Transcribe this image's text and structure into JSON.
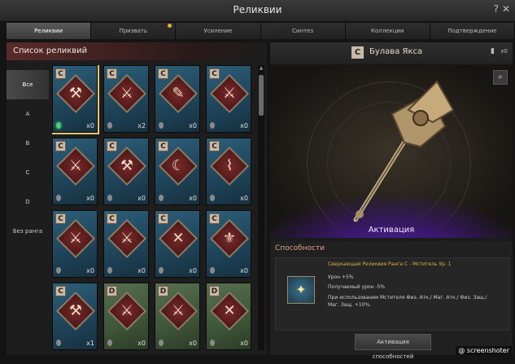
{
  "window": {
    "title": "Реликвии",
    "help": "?",
    "close": "✕"
  },
  "tabs": [
    {
      "label": "Реликвии",
      "active": true
    },
    {
      "label": "Призвать",
      "badge": true
    },
    {
      "label": "Усиление"
    },
    {
      "label": "Синтез"
    },
    {
      "label": "Коллекции"
    },
    {
      "label": "Подтверждение"
    }
  ],
  "left": {
    "title": "Список реликвий",
    "filters": [
      "Все",
      "A",
      "B",
      "C",
      "D",
      "Без ранга"
    ],
    "cards": [
      {
        "grade": "C",
        "type": "c",
        "count": "x0",
        "selected": true,
        "green": true
      },
      {
        "grade": "C",
        "type": "c",
        "count": "x2"
      },
      {
        "grade": "C",
        "type": "c",
        "count": "x0"
      },
      {
        "grade": "C",
        "type": "c",
        "count": "x0"
      },
      {
        "grade": "C",
        "type": "c",
        "count": "x0"
      },
      {
        "grade": "C",
        "type": "c",
        "count": "x0"
      },
      {
        "grade": "C",
        "type": "c",
        "count": "x0"
      },
      {
        "grade": "C",
        "type": "c",
        "count": "x0"
      },
      {
        "grade": "C",
        "type": "c",
        "count": "x0"
      },
      {
        "grade": "C",
        "type": "c",
        "count": "x0"
      },
      {
        "grade": "C",
        "type": "c",
        "count": "x0"
      },
      {
        "grade": "C",
        "type": "c",
        "count": "x0"
      },
      {
        "grade": "C",
        "type": "c",
        "count": "x1"
      },
      {
        "grade": "D",
        "type": "d",
        "count": "x0"
      },
      {
        "grade": "D",
        "type": "d",
        "count": "x0"
      },
      {
        "grade": "D",
        "type": "d",
        "count": "x0"
      }
    ]
  },
  "right": {
    "grade": "C",
    "name": "Булава Якса",
    "bag_count": "x0",
    "activation": "Активация",
    "abilities_title": "Способности",
    "ability": {
      "line1": "Сверкающая Реликвия Ранга C - Мститель Ур. 1",
      "line2": "Урон +5%",
      "line3": "Получаемый урон -5%",
      "line4": "При использовании Мстителя Физ. Атк./ Маг. Атк./ Физ. Защ./ Маг. Защ. +10%."
    },
    "activate_button": "Активация способностей"
  },
  "watermark": "@ screenshoter"
}
